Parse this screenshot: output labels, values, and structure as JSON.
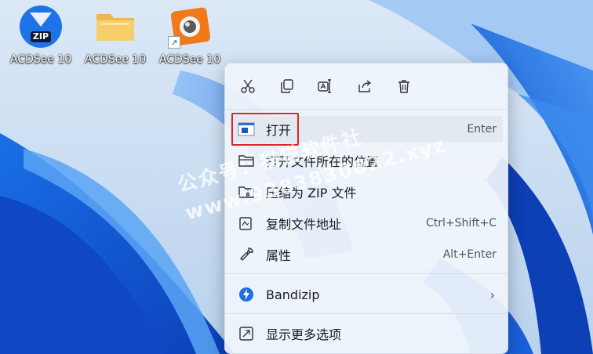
{
  "desktop": {
    "icons": [
      {
        "label": "ACDSee 10",
        "icon": "zip-file-icon",
        "badge": "ZIP"
      },
      {
        "label": "ACDSee 10",
        "icon": "folder-icon"
      },
      {
        "label": "ACDSee 10",
        "icon": "acdsee-app-icon",
        "shortcut_arrow": "↗"
      }
    ]
  },
  "context_menu": {
    "toolbar": [
      {
        "icon": "cut-icon"
      },
      {
        "icon": "copy-icon"
      },
      {
        "icon": "rename-icon"
      },
      {
        "icon": "share-icon"
      },
      {
        "icon": "delete-icon"
      }
    ],
    "items": [
      {
        "label": "打开",
        "shortcut": "Enter",
        "icon": "open-window-icon"
      },
      {
        "label": "打开文件所在的位置",
        "shortcut": "",
        "icon": "folder-outline-icon"
      },
      {
        "label": "压缩为 ZIP 文件",
        "shortcut": "",
        "icon": "zip-folder-icon"
      },
      {
        "label": "复制文件地址",
        "shortcut": "Ctrl+Shift+C",
        "icon": "copy-path-icon"
      },
      {
        "label": "属性",
        "shortcut": "Alt+Enter",
        "icon": "wrench-icon"
      },
      {
        "label": "Bandizip",
        "submenu_arrow": "›",
        "icon": "bandizip-icon"
      },
      {
        "label": "显示更多选项",
        "shortcut": "",
        "icon": "more-options-icon"
      }
    ]
  },
  "watermark": {
    "line1": "公众号：猫猫软件社",
    "line2": "www.9383830822.xyz"
  },
  "colors": {
    "accent_blue": "#1a6fd8",
    "highlight_red": "#e0262b",
    "menu_bg": "#f0f5fb"
  }
}
